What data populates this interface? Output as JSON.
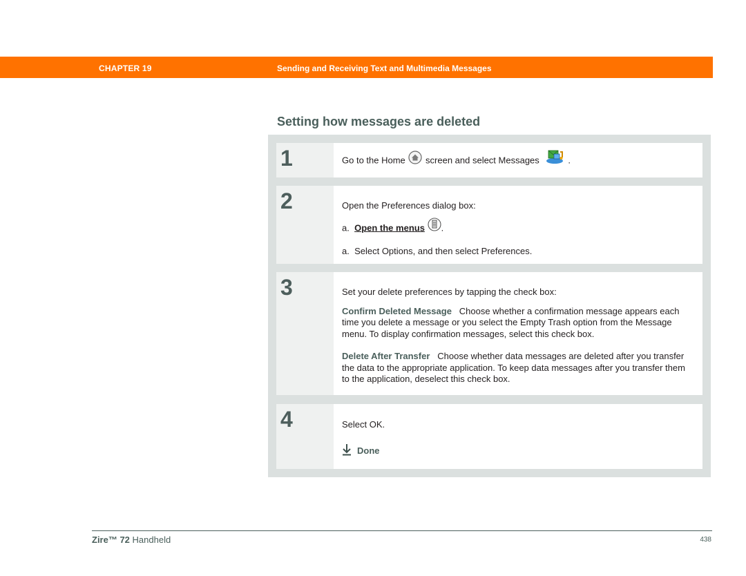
{
  "header": {
    "chapter_label": "CHAPTER 19",
    "chapter_title": "Sending and Receiving Text and Multimedia Messages",
    "bar_color": "#ff7200"
  },
  "section": {
    "heading": "Setting how messages are deleted"
  },
  "steps": [
    {
      "number": "1",
      "text_before_home_icon": "Go to the Home",
      "text_after_home_icon": "screen and select Messages",
      "text_end": ".",
      "icons": [
        "home-icon",
        "messages-app-icon"
      ]
    },
    {
      "number": "2",
      "intro": "Open the Preferences dialog box:",
      "substeps": [
        {
          "marker": "a.",
          "link_text": "Open the menus",
          "icon": "menu-icon",
          "suffix": "."
        },
        {
          "marker": "a.",
          "text": "Select Options, and then select Preferences."
        }
      ]
    },
    {
      "number": "3",
      "intro": "Set your delete preferences by tapping the check box:",
      "options": [
        {
          "term": "Confirm Deleted Message",
          "description": "Choose whether a confirmation message appears each time you delete a message or you select the Empty Trash option from the Message menu. To display confirmation messages, select this check box."
        },
        {
          "term": "Delete After Transfer",
          "description": "Choose whether data messages are deleted after you transfer the data to the appropriate application. To keep data messages after you transfer them to the application, deselect this check box."
        }
      ]
    },
    {
      "number": "4",
      "text": "Select OK.",
      "done_label": "Done",
      "done_icon": "down-arrow-done-icon"
    }
  ],
  "footer": {
    "product_bold": "Zire™ 72",
    "product_rest": " Handheld",
    "page_number": "438"
  }
}
